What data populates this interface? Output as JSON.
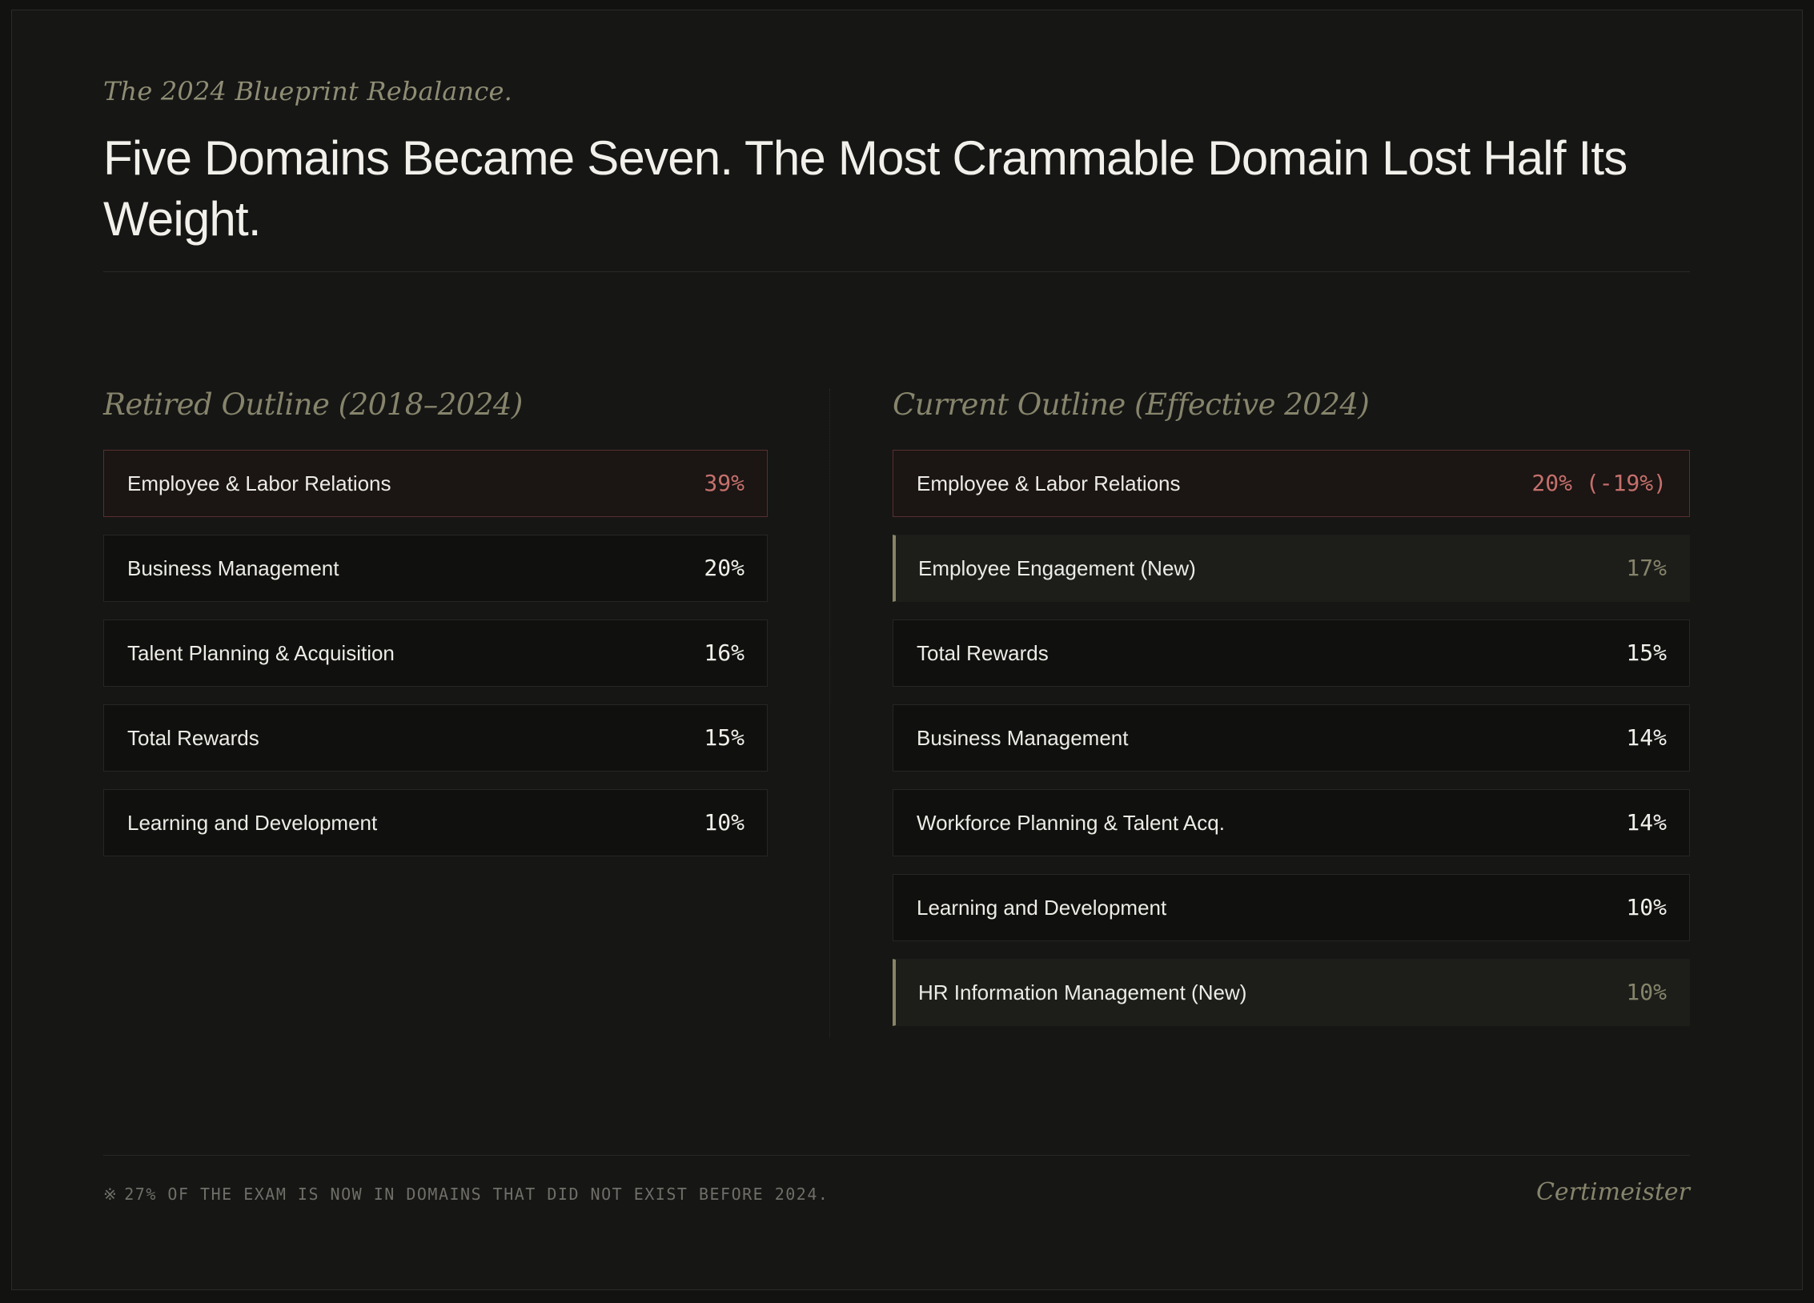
{
  "header": {
    "eyebrow": "The 2024 Blueprint Rebalance.",
    "title": "Five Domains Became Seven. The Most Crammable Domain Lost Half Its Weight."
  },
  "retired": {
    "title": "Retired Outline (2018–2024)",
    "items": [
      {
        "name": "Employee & Labor Relations",
        "pct": "39%"
      },
      {
        "name": "Business Management",
        "pct": "20%"
      },
      {
        "name": "Talent Planning & Acquisition",
        "pct": "16%"
      },
      {
        "name": "Total Rewards",
        "pct": "15%"
      },
      {
        "name": "Learning and Development",
        "pct": "10%"
      }
    ]
  },
  "current": {
    "title": "Current Outline (Effective 2024)",
    "items": [
      {
        "name": "Employee & Labor Relations",
        "pct": "20% (-19%)"
      },
      {
        "name": "Employee Engagement (New)",
        "pct": "17%"
      },
      {
        "name": "Total Rewards",
        "pct": "15%"
      },
      {
        "name": "Business Management",
        "pct": "14%"
      },
      {
        "name": "Workforce Planning & Talent Acq.",
        "pct": "14%"
      },
      {
        "name": "Learning and Development",
        "pct": "10%"
      },
      {
        "name": "HR Information Management (New)",
        "pct": "10%"
      }
    ]
  },
  "footer": {
    "mark": "※",
    "note": "27% OF THE EXAM IS NOW IN DOMAINS THAT DID NOT EXIST BEFORE 2024.",
    "brand": "Certimeister"
  },
  "colors": {
    "background": "#161615",
    "accent_olive": "#868466",
    "highlight_red": "#c4706c"
  }
}
